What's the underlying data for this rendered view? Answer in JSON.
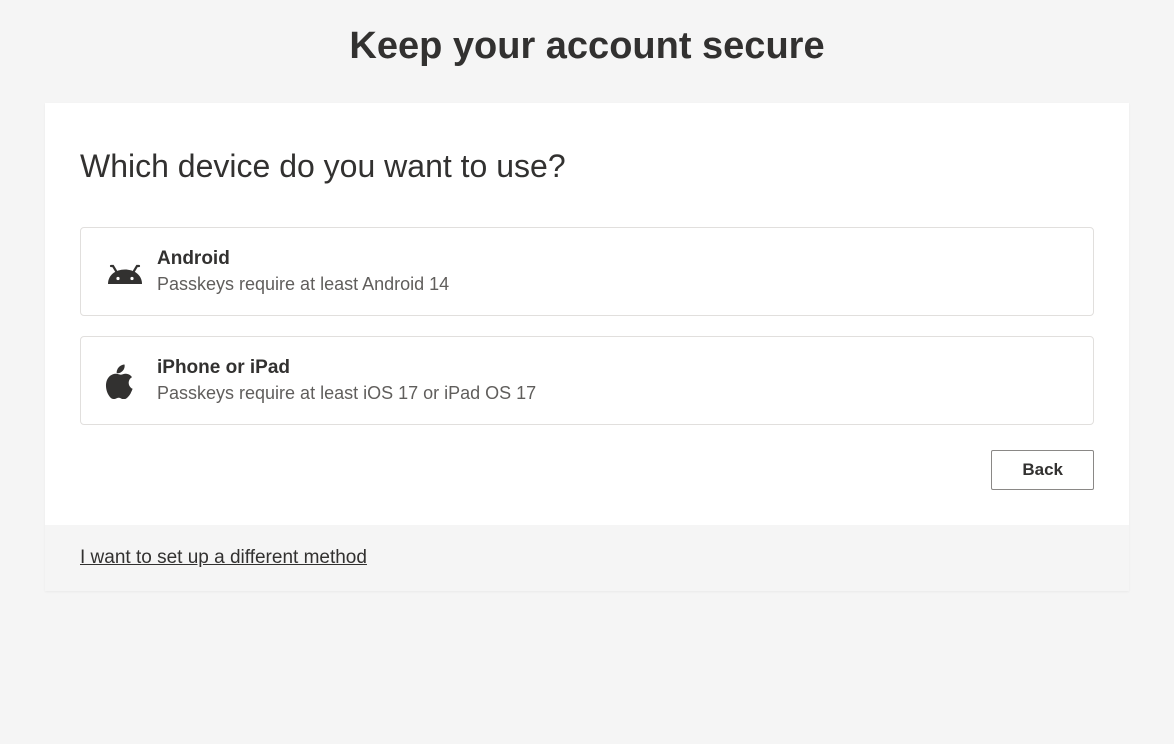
{
  "header": {
    "title": "Keep your account secure"
  },
  "main": {
    "heading": "Which device do you want to use?",
    "options": [
      {
        "icon": "android",
        "title": "Android",
        "subtitle": "Passkeys require at least Android 14"
      },
      {
        "icon": "apple",
        "title": "iPhone or iPad",
        "subtitle": "Passkeys require at least iOS 17 or iPad OS 17"
      }
    ],
    "back_button": "Back"
  },
  "footer": {
    "alt_method_link": "I want to set up a different method"
  }
}
